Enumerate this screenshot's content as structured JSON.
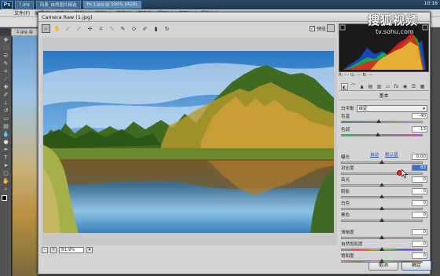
{
  "taskbar": {
    "ps_logo": "Ps",
    "buttons": [
      {
        "label": "1.jpg"
      },
      {
        "label": "风景_自然图片精选"
      },
      {
        "label": "Ps 1.jpg @ 100% (RGB)"
      }
    ],
    "time": "10:16"
  },
  "menubar": {
    "items": [
      "文件(F)",
      "编辑(E)",
      "图像(I)",
      "图层(L)",
      "文字(Y)",
      "选择(S)",
      "滤镜(T)",
      "视图(V)",
      "窗口(W)",
      "帮助(H)"
    ]
  },
  "document_tab": "1.jpg @",
  "watermark": {
    "main": "搜狐视频",
    "sub": "tv.sohu.com"
  },
  "dialog": {
    "title": "Camera Raw (1.jpg)",
    "preview_label": "预览",
    "preview_checked": true,
    "zoom_value": "81.9%",
    "zoom_out_label": "-",
    "zoom_in_label": "+",
    "cancel_label": "取消",
    "ok_label": "确定",
    "tools": [
      "zoom-icon",
      "hand-icon",
      "white-balance-icon",
      "color-sampler-icon",
      "target-adjust-icon",
      "crop-icon",
      "straighten-icon",
      "spot-removal-icon",
      "red-eye-icon",
      "adjust-brush-icon",
      "graduated-filter-icon",
      "rotate-icon"
    ]
  },
  "panel": {
    "rgb_readout": "R:  ---   G:  ---   B:  ---",
    "section_title": "基本",
    "white_balance_label": "白平衡",
    "white_balance_value": "自定",
    "auto_link": "自动",
    "default_link": "默认值",
    "sliders": [
      {
        "label": "色温",
        "value": "-40",
        "pos": 0.46,
        "track": "temp"
      },
      {
        "label": "色调",
        "value": "-13",
        "pos": 0.45,
        "track": "tint"
      },
      {
        "label": "曝光",
        "value": "0.00",
        "pos": 0.5,
        "track": "gray"
      },
      {
        "label": "对比度",
        "value": "83",
        "pos": 0.72,
        "track": "gray",
        "highlight": true
      },
      {
        "label": "高光",
        "value": "0",
        "pos": 0.5,
        "track": "gray"
      },
      {
        "label": "阴影",
        "value": "0",
        "pos": 0.5,
        "track": "gray"
      },
      {
        "label": "白色",
        "value": "0",
        "pos": 0.5,
        "track": "gray"
      },
      {
        "label": "黑色",
        "value": "0",
        "pos": 0.5,
        "track": "gray"
      },
      {
        "label": "清晰度",
        "value": "0",
        "pos": 0.5,
        "track": "gray"
      },
      {
        "label": "自然饱和度",
        "value": "0",
        "pos": 0.5,
        "track": "sat"
      },
      {
        "label": "饱和度",
        "value": "0",
        "pos": 0.5,
        "track": "sat"
      }
    ]
  },
  "colors": {
    "accent": "#3870d8",
    "dialog_bg": "#d4d4d4",
    "pointer": "#e22222"
  }
}
